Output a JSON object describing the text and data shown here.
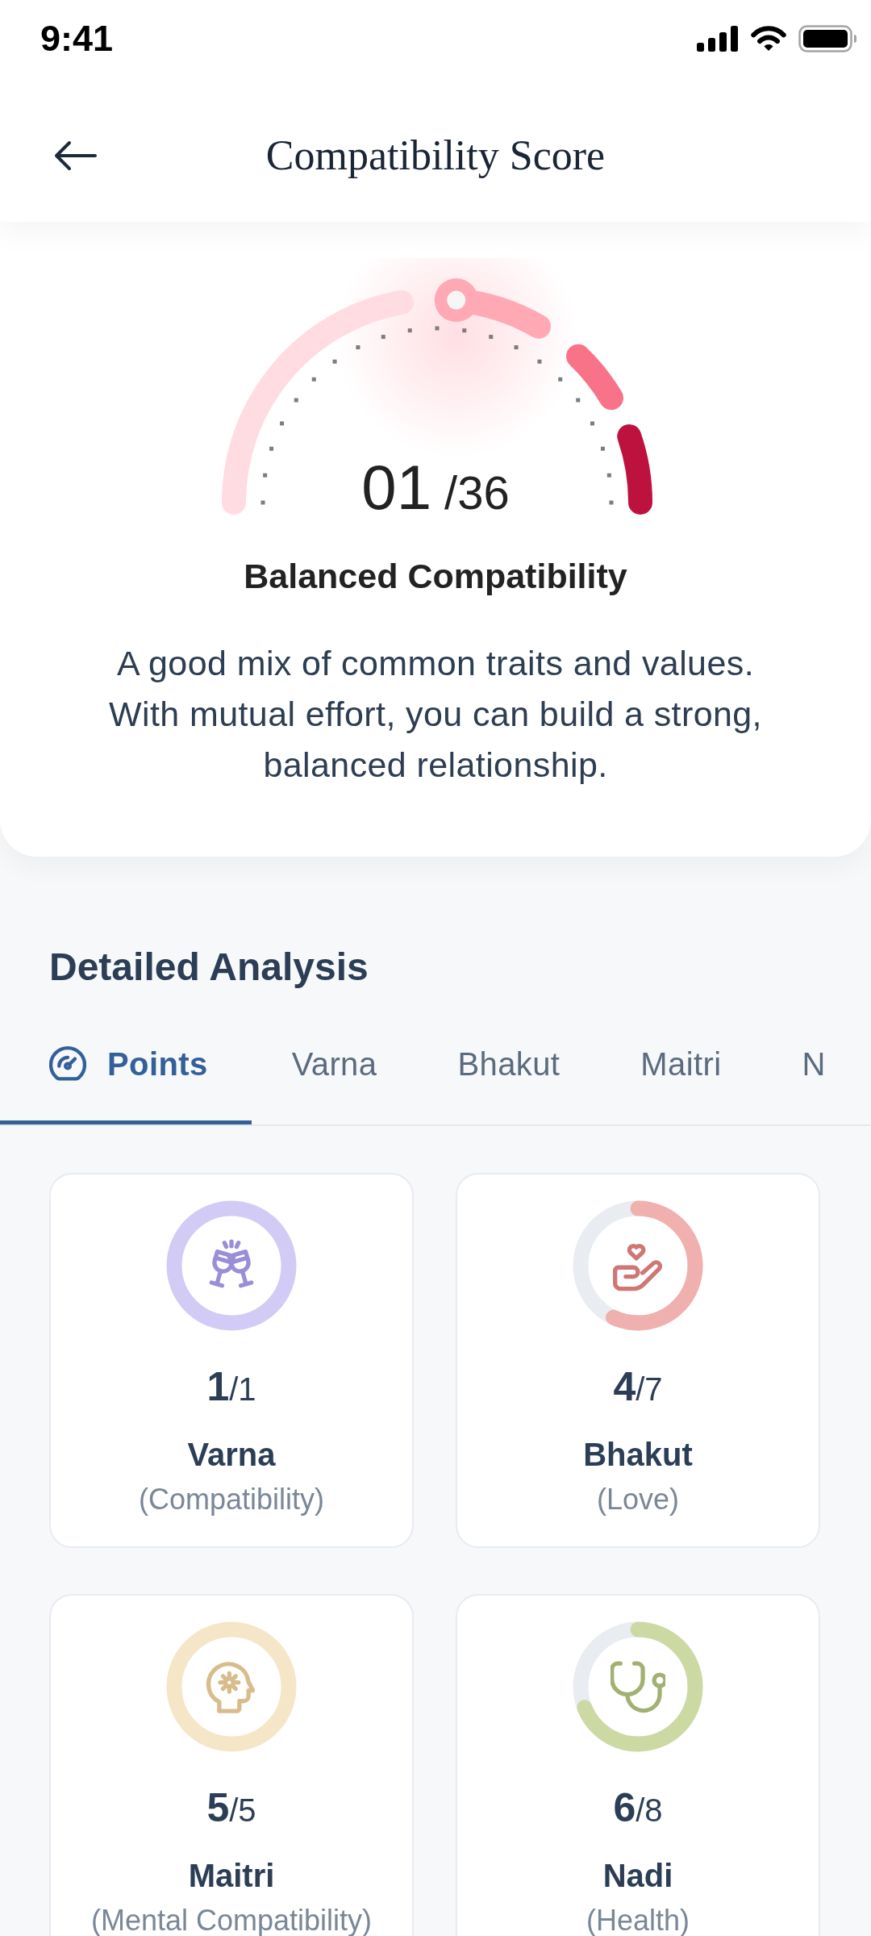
{
  "status_bar": {
    "time": "9:41"
  },
  "header": {
    "title": "Compatibility Score"
  },
  "summary": {
    "gauge": {
      "score": "01",
      "total": "/36",
      "level": 0.53
    },
    "title": "Balanced Compatibility",
    "description": "A good mix of common traits and values. With mutual effort, you can build a strong, balanced relationship."
  },
  "analysis": {
    "title": "Detailed Analysis",
    "tabs": [
      {
        "label": "Points",
        "selected": true
      },
      {
        "label": "Varna",
        "selected": false
      },
      {
        "label": "Bhakut",
        "selected": false
      },
      {
        "label": "Maitri",
        "selected": false
      },
      {
        "label": "N",
        "selected": false
      }
    ],
    "cards": [
      {
        "score": "**1**/1",
        "name": "Varna",
        "subtitle": "(Compatibility)",
        "level": 1,
        "color": "#d2cbf5"
      },
      {
        "score": "**4**/7",
        "name": "Bhakut",
        "subtitle": "(Love)",
        "level": 0.57,
        "color": "#f0b0ae"
      },
      {
        "score": "**5**/5",
        "name": "Maitri",
        "subtitle": "(Mental Compatibility)",
        "level": 1,
        "color": "#f5e6c8"
      },
      {
        "score": "**6**/8",
        "name": "Nadi",
        "subtitle": "(Health)",
        "level": 0.69,
        "color": "#cdd9a3"
      }
    ]
  }
}
